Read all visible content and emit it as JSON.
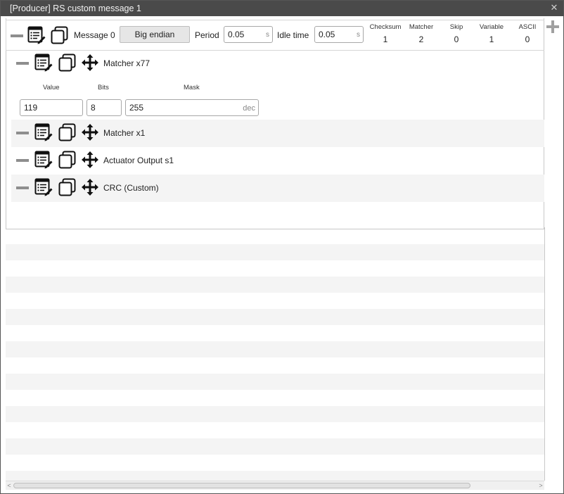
{
  "window": {
    "title": "[Producer] RS custom message 1",
    "close_glyph": "✕"
  },
  "message": {
    "label": "Message 0",
    "endian_button": "Big endian",
    "period_label": "Period",
    "period_value": "0.05",
    "period_unit": "s",
    "idle_label": "Idle time",
    "idle_value": "0.05",
    "idle_unit": "s"
  },
  "stats": [
    {
      "label": "Checksum",
      "value": "1"
    },
    {
      "label": "Matcher",
      "value": "2"
    },
    {
      "label": "Skip",
      "value": "0"
    },
    {
      "label": "Variable",
      "value": "1"
    },
    {
      "label": "ASCII",
      "value": "0"
    }
  ],
  "rows": [
    {
      "label": "Matcher x77",
      "fields": {
        "value_label": "Value",
        "bits_label": "Bits",
        "mask_label": "Mask",
        "value": "119",
        "bits": "8",
        "mask": "255",
        "mask_unit": "dec"
      }
    },
    {
      "label": "Matcher x1"
    },
    {
      "label": "Actuator Output s1"
    },
    {
      "label": "CRC (Custom)"
    }
  ],
  "scroll": {
    "left_arrow": "<",
    "right_arrow": ">"
  },
  "icons": [
    "list-edit-icon",
    "copy-icon",
    "move-icon",
    "minus-icon",
    "plus-icon",
    "close-icon"
  ],
  "colors": {
    "titlebar": "#4a4a4a",
    "stripe": "#f4f4f4",
    "button": "#e6e6e6"
  }
}
